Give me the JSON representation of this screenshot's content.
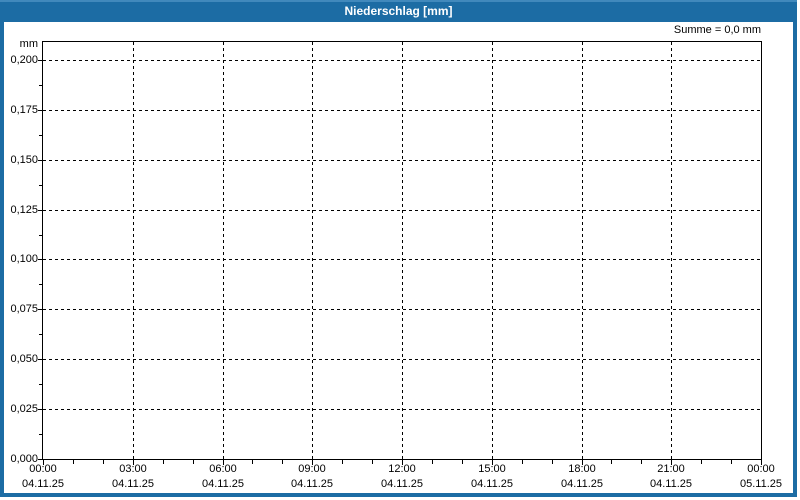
{
  "window": {
    "title": "Niederschlag [mm]"
  },
  "summary_label": "Summe = 0,0 mm",
  "axis_unit": "mm",
  "chart_data": {
    "type": "line",
    "title": "Niederschlag [mm]",
    "xlabel": "",
    "ylabel": "mm",
    "ylim": [
      0,
      0.209
    ],
    "y_tick_step": 0.025,
    "y_ticks": [
      "0,000",
      "0,025",
      "0,050",
      "0,075",
      "0,100",
      "0,125",
      "0,150",
      "0,175",
      "0,200"
    ],
    "x_hours_range": [
      0,
      24
    ],
    "x_major_step_hours": 3,
    "x_minor_step_hours": 1,
    "x_ticks": [
      {
        "time": "00:00",
        "date": "04.11.25"
      },
      {
        "time": "03:00",
        "date": "04.11.25"
      },
      {
        "time": "06:00",
        "date": "04.11.25"
      },
      {
        "time": "09:00",
        "date": "04.11.25"
      },
      {
        "time": "12:00",
        "date": "04.11.25"
      },
      {
        "time": "15:00",
        "date": "04.11.25"
      },
      {
        "time": "18:00",
        "date": "04.11.25"
      },
      {
        "time": "21:00",
        "date": "04.11.25"
      },
      {
        "time": "00:00",
        "date": "05.11.25"
      }
    ],
    "grid": "dashed",
    "legend": "none",
    "series": [
      {
        "name": "Niederschlag",
        "unit": "mm",
        "values": [],
        "sum_label": "Summe = 0,0 mm",
        "sum_value": "0,0"
      }
    ]
  },
  "colors": {
    "header_bg": "#1c6ca4",
    "header_text": "#ffffff",
    "frame_border": "#1c6ca4",
    "plot_border": "#000000",
    "grid": "#000000",
    "label_text": "#000000",
    "plot_bg": "#ffffff"
  }
}
